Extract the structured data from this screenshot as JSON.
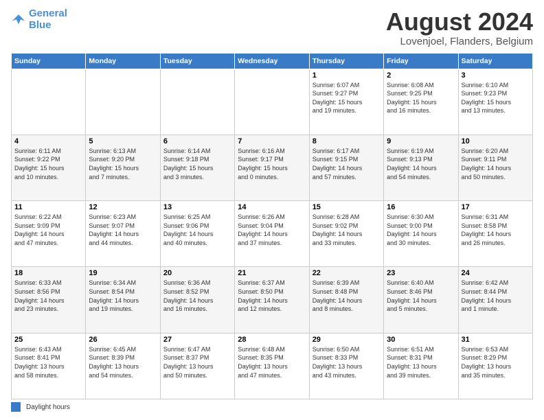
{
  "logo": {
    "line1": "General",
    "line2": "Blue"
  },
  "title": "August 2024",
  "location": "Lovenjoel, Flanders, Belgium",
  "weekdays": [
    "Sunday",
    "Monday",
    "Tuesday",
    "Wednesday",
    "Thursday",
    "Friday",
    "Saturday"
  ],
  "footer_label": "Daylight hours",
  "weeks": [
    [
      {
        "day": "",
        "info": ""
      },
      {
        "day": "",
        "info": ""
      },
      {
        "day": "",
        "info": ""
      },
      {
        "day": "",
        "info": ""
      },
      {
        "day": "1",
        "info": "Sunrise: 6:07 AM\nSunset: 9:27 PM\nDaylight: 15 hours\nand 19 minutes."
      },
      {
        "day": "2",
        "info": "Sunrise: 6:08 AM\nSunset: 9:25 PM\nDaylight: 15 hours\nand 16 minutes."
      },
      {
        "day": "3",
        "info": "Sunrise: 6:10 AM\nSunset: 9:23 PM\nDaylight: 15 hours\nand 13 minutes."
      }
    ],
    [
      {
        "day": "4",
        "info": "Sunrise: 6:11 AM\nSunset: 9:22 PM\nDaylight: 15 hours\nand 10 minutes."
      },
      {
        "day": "5",
        "info": "Sunrise: 6:13 AM\nSunset: 9:20 PM\nDaylight: 15 hours\nand 7 minutes."
      },
      {
        "day": "6",
        "info": "Sunrise: 6:14 AM\nSunset: 9:18 PM\nDaylight: 15 hours\nand 3 minutes."
      },
      {
        "day": "7",
        "info": "Sunrise: 6:16 AM\nSunset: 9:17 PM\nDaylight: 15 hours\nand 0 minutes."
      },
      {
        "day": "8",
        "info": "Sunrise: 6:17 AM\nSunset: 9:15 PM\nDaylight: 14 hours\nand 57 minutes."
      },
      {
        "day": "9",
        "info": "Sunrise: 6:19 AM\nSunset: 9:13 PM\nDaylight: 14 hours\nand 54 minutes."
      },
      {
        "day": "10",
        "info": "Sunrise: 6:20 AM\nSunset: 9:11 PM\nDaylight: 14 hours\nand 50 minutes."
      }
    ],
    [
      {
        "day": "11",
        "info": "Sunrise: 6:22 AM\nSunset: 9:09 PM\nDaylight: 14 hours\nand 47 minutes."
      },
      {
        "day": "12",
        "info": "Sunrise: 6:23 AM\nSunset: 9:07 PM\nDaylight: 14 hours\nand 44 minutes."
      },
      {
        "day": "13",
        "info": "Sunrise: 6:25 AM\nSunset: 9:06 PM\nDaylight: 14 hours\nand 40 minutes."
      },
      {
        "day": "14",
        "info": "Sunrise: 6:26 AM\nSunset: 9:04 PM\nDaylight: 14 hours\nand 37 minutes."
      },
      {
        "day": "15",
        "info": "Sunrise: 6:28 AM\nSunset: 9:02 PM\nDaylight: 14 hours\nand 33 minutes."
      },
      {
        "day": "16",
        "info": "Sunrise: 6:30 AM\nSunset: 9:00 PM\nDaylight: 14 hours\nand 30 minutes."
      },
      {
        "day": "17",
        "info": "Sunrise: 6:31 AM\nSunset: 8:58 PM\nDaylight: 14 hours\nand 26 minutes."
      }
    ],
    [
      {
        "day": "18",
        "info": "Sunrise: 6:33 AM\nSunset: 8:56 PM\nDaylight: 14 hours\nand 23 minutes."
      },
      {
        "day": "19",
        "info": "Sunrise: 6:34 AM\nSunset: 8:54 PM\nDaylight: 14 hours\nand 19 minutes."
      },
      {
        "day": "20",
        "info": "Sunrise: 6:36 AM\nSunset: 8:52 PM\nDaylight: 14 hours\nand 16 minutes."
      },
      {
        "day": "21",
        "info": "Sunrise: 6:37 AM\nSunset: 8:50 PM\nDaylight: 14 hours\nand 12 minutes."
      },
      {
        "day": "22",
        "info": "Sunrise: 6:39 AM\nSunset: 8:48 PM\nDaylight: 14 hours\nand 8 minutes."
      },
      {
        "day": "23",
        "info": "Sunrise: 6:40 AM\nSunset: 8:46 PM\nDaylight: 14 hours\nand 5 minutes."
      },
      {
        "day": "24",
        "info": "Sunrise: 6:42 AM\nSunset: 8:44 PM\nDaylight: 14 hours\nand 1 minute."
      }
    ],
    [
      {
        "day": "25",
        "info": "Sunrise: 6:43 AM\nSunset: 8:41 PM\nDaylight: 13 hours\nand 58 minutes."
      },
      {
        "day": "26",
        "info": "Sunrise: 6:45 AM\nSunset: 8:39 PM\nDaylight: 13 hours\nand 54 minutes."
      },
      {
        "day": "27",
        "info": "Sunrise: 6:47 AM\nSunset: 8:37 PM\nDaylight: 13 hours\nand 50 minutes."
      },
      {
        "day": "28",
        "info": "Sunrise: 6:48 AM\nSunset: 8:35 PM\nDaylight: 13 hours\nand 47 minutes."
      },
      {
        "day": "29",
        "info": "Sunrise: 6:50 AM\nSunset: 8:33 PM\nDaylight: 13 hours\nand 43 minutes."
      },
      {
        "day": "30",
        "info": "Sunrise: 6:51 AM\nSunset: 8:31 PM\nDaylight: 13 hours\nand 39 minutes."
      },
      {
        "day": "31",
        "info": "Sunrise: 6:53 AM\nSunset: 8:29 PM\nDaylight: 13 hours\nand 35 minutes."
      }
    ]
  ]
}
